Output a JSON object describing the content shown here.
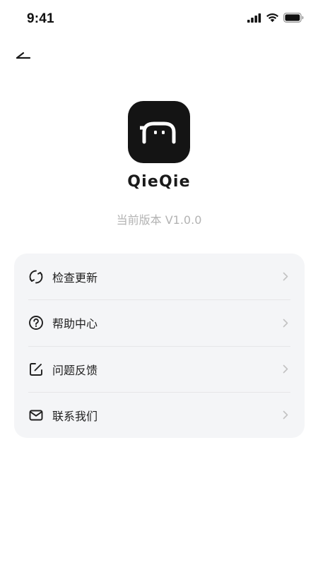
{
  "status_bar": {
    "time": "9:41"
  },
  "header": {
    "back_icon": "back-arrow-icon"
  },
  "app": {
    "name": "QieQie",
    "version_label": "当前版本 V1.0.0",
    "logo_icon": "qieqie-logo-icon"
  },
  "menu": {
    "items": [
      {
        "label": "检查更新",
        "icon": "refresh-icon"
      },
      {
        "label": "帮助中心",
        "icon": "help-circle-icon"
      },
      {
        "label": "问题反馈",
        "icon": "edit-icon"
      },
      {
        "label": "联系我们",
        "icon": "mail-icon"
      }
    ]
  },
  "colors": {
    "background": "#ffffff",
    "card": "#f4f5f7",
    "logo_bg": "#141414",
    "muted_text": "#b3b3b3",
    "chevron": "#c2c2c2"
  }
}
